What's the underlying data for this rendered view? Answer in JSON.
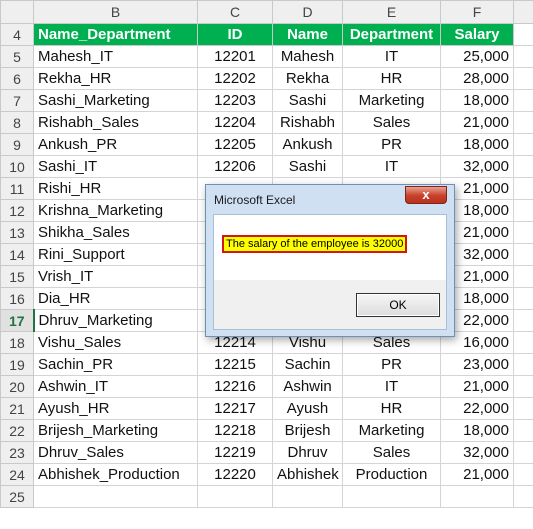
{
  "column_headers": [
    "B",
    "C",
    "D",
    "E",
    "F"
  ],
  "header_row": {
    "row_number": "4",
    "cells": [
      "Name_Department",
      "ID",
      "Name",
      "Department",
      "Salary"
    ]
  },
  "rows": [
    {
      "row_number": "5",
      "cells": [
        "Mahesh_IT",
        "12201",
        "Mahesh",
        "IT",
        "25,000"
      ]
    },
    {
      "row_number": "6",
      "cells": [
        "Rekha_HR",
        "12202",
        "Rekha",
        "HR",
        "28,000"
      ]
    },
    {
      "row_number": "7",
      "cells": [
        "Sashi_Marketing",
        "12203",
        "Sashi",
        "Marketing",
        "18,000"
      ]
    },
    {
      "row_number": "8",
      "cells": [
        "Rishabh_Sales",
        "12204",
        "Rishabh",
        "Sales",
        "21,000"
      ]
    },
    {
      "row_number": "9",
      "cells": [
        "Ankush_PR",
        "12205",
        "Ankush",
        "PR",
        "18,000"
      ]
    },
    {
      "row_number": "10",
      "cells": [
        "Sashi_IT",
        "12206",
        "Sashi",
        "IT",
        "32,000"
      ]
    },
    {
      "row_number": "11",
      "cells": [
        "Rishi_HR",
        "",
        "",
        "",
        "21,000"
      ]
    },
    {
      "row_number": "12",
      "cells": [
        "Krishna_Marketing",
        "",
        "",
        "",
        "18,000"
      ]
    },
    {
      "row_number": "13",
      "cells": [
        "Shikha_Sales",
        "",
        "",
        "",
        "21,000"
      ]
    },
    {
      "row_number": "14",
      "cells": [
        "Rini_Support",
        "",
        "",
        "",
        "32,000"
      ]
    },
    {
      "row_number": "15",
      "cells": [
        "Vrish_IT",
        "",
        "",
        "",
        "21,000"
      ]
    },
    {
      "row_number": "16",
      "cells": [
        "Dia_HR",
        "",
        "",
        "",
        "18,000"
      ]
    },
    {
      "row_number": "17",
      "cells": [
        "Dhruv_Marketing",
        "",
        "",
        "",
        "22,000"
      ]
    },
    {
      "row_number": "18",
      "cells": [
        "Vishu_Sales",
        "12214",
        "Vishu",
        "Sales",
        "16,000"
      ]
    },
    {
      "row_number": "19",
      "cells": [
        "Sachin_PR",
        "12215",
        "Sachin",
        "PR",
        "23,000"
      ]
    },
    {
      "row_number": "20",
      "cells": [
        "Ashwin_IT",
        "12216",
        "Ashwin",
        "IT",
        "21,000"
      ]
    },
    {
      "row_number": "21",
      "cells": [
        "Ayush_HR",
        "12217",
        "Ayush",
        "HR",
        "22,000"
      ]
    },
    {
      "row_number": "22",
      "cells": [
        "Brijesh_Marketing",
        "12218",
        "Brijesh",
        "Marketing",
        "18,000"
      ]
    },
    {
      "row_number": "23",
      "cells": [
        "Dhruv_Sales",
        "12219",
        "Dhruv",
        "Sales",
        "32,000"
      ]
    },
    {
      "row_number": "24",
      "cells": [
        "Abhishek_Production",
        "12220",
        "Abhishek",
        "Production",
        "21,000"
      ]
    },
    {
      "row_number": "25",
      "cells": [
        "",
        "",
        "",
        "",
        ""
      ]
    }
  ],
  "dialog": {
    "title": "Microsoft Excel",
    "close_label": "x",
    "message": "The salary of the employee is 32000",
    "ok_label": "OK"
  }
}
